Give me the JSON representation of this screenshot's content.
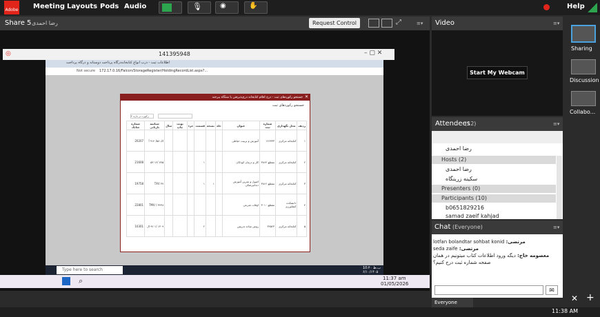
{
  "menu": {
    "logo": "Adobe",
    "items": [
      "Meeting",
      "Layouts",
      "Pods",
      "Audio"
    ],
    "help": "Help"
  },
  "share": {
    "title": "Share 5",
    "subtitle": "رضا احمدی",
    "request_control": "Request Control"
  },
  "remote": {
    "session_id": "141395948"
  },
  "browser": {
    "tab1": "اطلاعات ثبت - درب انواع کتابخانه",
    "tab2": "درگاه پرداخت دوستانه و درگاه پرداخت",
    "security": "Not secure",
    "url": "172.17.0.16/Falcon/StorageRegister/HoldingRecordList.aspx?...",
    "modal_title": "جستجو رکوردهای ثبت - درج اقلام کتابخانه درج‌پذیرفتن یا شتگاه بیرجند",
    "modal_sub": "جستجو رکوردهای ثبت",
    "headers": [
      "ردیف",
      "محل نگهداری",
      "شماره ثبت",
      "عنوان",
      "جلد",
      "نسخه",
      "قسمت",
      "جزء",
      "نوبت چاپ",
      "سال",
      "شناسه بازیابی",
      "شماره شابک"
    ],
    "rows": [
      [
        "۱",
        "کتابخانه مرکزی",
        "۱۲۶۳۳۳",
        "آموزش و تربیت خیاطی",
        "",
        "",
        "",
        "",
        "",
        "",
        "اک ۵۸/ ۹۱۲ آ",
        "20207"
      ],
      [
        "۲",
        "کتابخانه مرکزی",
        "مقطع ۳۸۶۴",
        "کار و درمان کودکان",
        "",
        "",
        "۱",
        "",
        "",
        "",
        "۷۷۵ /۱۲ ۵۳",
        "21608"
      ],
      [
        "۳",
        "کتابخانه مرکزی",
        "مقطع ۳۸۶۶",
        "اصول و تمرین آموزش دندانپزشکی",
        "",
        "۱",
        "۱",
        "",
        "",
        "",
        "TXV ۳۷",
        "19758"
      ],
      [
        "۴",
        "دانشکده کشاورزی",
        "مقطع ۳۰۱۰",
        "اوقات شرعی",
        "",
        "",
        "",
        "",
        "",
        "",
        "۳۴۳۸ / TMV",
        "22801"
      ],
      [
        "۵",
        "کتابخانه مرکزی",
        "۳۴۵۲۳",
        "روش ساده تدریس",
        "",
        "",
        "۲",
        "",
        "",
        "",
        "۱۳۰۹ /۱ ۹۲ ال",
        "10301"
      ]
    ],
    "search_placeholder": "ابزار",
    "search_btn": "۴ رکورد در بازه",
    "taskbar_search": "Type here to search",
    "remote_time": "10:۴۰ ب.ظ",
    "remote_date": "۶/۱۰/۱۴۰۵"
  },
  "local_clock": {
    "time": "11:37 am",
    "date": "01/05/2026"
  },
  "video": {
    "title": "Video",
    "start_btn": "Start My Webcam"
  },
  "attendees": {
    "title": "Attendees",
    "count": "(12)",
    "presenter_line": "رضا احمدی",
    "hosts": "Hosts (2)",
    "host1": "رضا احمدی",
    "host2": "سکینه زرینگاه",
    "presenters": "Presenters (0)",
    "participants": "Participants (10)",
    "p1": "b0651829216",
    "p2": "samad zaeif kahjad"
  },
  "chat": {
    "title": "Chat",
    "scope": "(Everyone)",
    "footer": "Everyone",
    "messages": [
      {
        "from": "مرتضی:",
        "text": "lotfan bolandtar sohbat konid"
      },
      {
        "from": "مرتضی:",
        "text": "seda zaife"
      },
      {
        "from": "معصومه خاج:",
        "text": "دیگه ورود اطلاعات کتاب میتونیم در همان صفحه شماره ثبت درج کنیم؟"
      }
    ]
  },
  "layouts": {
    "items": [
      "Sharing",
      "Discussion",
      "Collabo..."
    ]
  },
  "os_clock": {
    "time": "11:38 AM"
  },
  "colors": {
    "accent": "#8a1f1f",
    "brand": "#e1251b",
    "mic_on": "#2da44e"
  }
}
